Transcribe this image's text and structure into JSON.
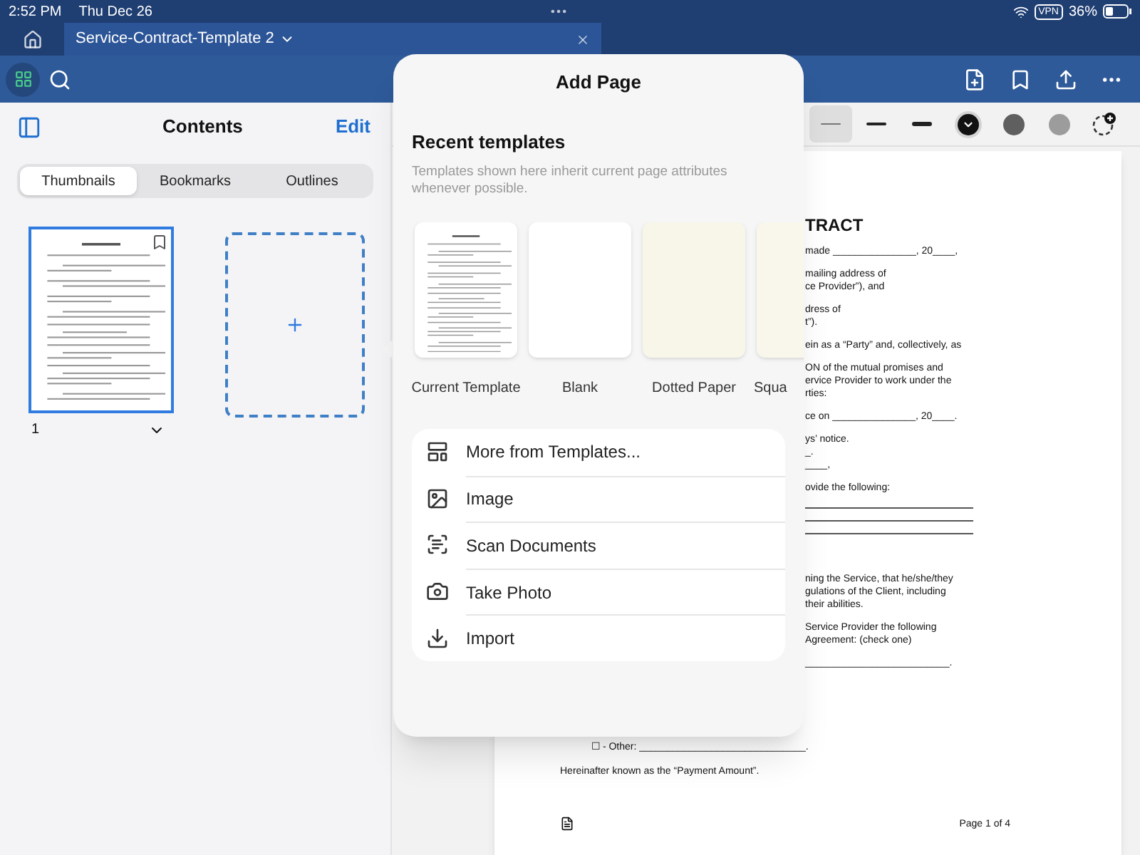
{
  "status_bar": {
    "time": "2:52 PM",
    "date": "Thu Dec 26",
    "vpn": "VPN",
    "battery": "36%"
  },
  "tabs": [
    {
      "title": "Service-Contract-Template 2",
      "selected": true
    }
  ],
  "sidebar": {
    "title": "Contents",
    "edit": "Edit",
    "segments": [
      {
        "label": "Thumbnails",
        "selected": true
      },
      {
        "label": "Bookmarks",
        "selected": false
      },
      {
        "label": "Outlines",
        "selected": false
      }
    ],
    "thumbnails": [
      {
        "page_number": "1",
        "selected": true
      }
    ]
  },
  "pen_toolbar": [
    {
      "kind": "thickness",
      "selected": true
    },
    {
      "kind": "thickness",
      "selected": false
    },
    {
      "kind": "thickness",
      "selected": false
    },
    {
      "kind": "color",
      "color": "#111111",
      "selected": true
    },
    {
      "kind": "color",
      "color": "#5f5f5f",
      "selected": false
    },
    {
      "kind": "color",
      "color": "#9c9c9c",
      "selected": false
    },
    {
      "kind": "add"
    }
  ],
  "popover": {
    "title": "Add Page",
    "section_title": "Recent templates",
    "hint": "Templates shown here inherit current page attributes whenever possible.",
    "templates": [
      {
        "label": "Current Template",
        "kind": "document"
      },
      {
        "label": "Blank",
        "kind": "blank"
      },
      {
        "label": "Dotted Paper",
        "kind": "dotted"
      },
      {
        "label": "Squa",
        "kind": "squared"
      }
    ],
    "actions": [
      {
        "label": "More from Templates...",
        "kind": "templates"
      },
      {
        "label": "Image",
        "kind": "image"
      },
      {
        "label": "Scan Documents",
        "kind": "scan"
      },
      {
        "label": "Take Photo",
        "kind": "camera"
      },
      {
        "label": "Import",
        "kind": "import"
      }
    ]
  },
  "document": {
    "paragraphs": [
      {
        "kind": "heading",
        "lines": [
          "TRACT"
        ]
      },
      {
        "kind": "text",
        "lines": [
          "made _______________, 20____,"
        ]
      },
      {
        "kind": "text",
        "lines": [
          "mailing address of",
          "ce Provider”), and"
        ]
      },
      {
        "kind": "text",
        "lines": [
          "dress of",
          "t”)."
        ]
      },
      {
        "kind": "text",
        "lines": [
          "ein as a “Party” and, collectively, as"
        ]
      },
      {
        "kind": "text",
        "lines": [
          "ON of the mutual promises and",
          "ervice Provider to work under the",
          "rties:"
        ]
      },
      {
        "kind": "text",
        "lines": [
          "ce on _______________, 20____."
        ]
      },
      {
        "kind": "text",
        "lines": [
          "ys’ notice.",
          "_.",
          "____,"
        ]
      },
      {
        "kind": "text",
        "lines": [
          "ovide the following:"
        ]
      },
      {
        "kind": "rules"
      },
      {
        "kind": "text",
        "lines": [
          "ning the Service, that he/she/they",
          "gulations of the Client, including",
          "their abilities."
        ]
      },
      {
        "kind": "text",
        "lines": [
          "Service Provider the following",
          "Agreement: (check one)"
        ]
      },
      {
        "kind": "text",
        "lines": [
          "__________________________."
        ]
      }
    ],
    "lower_lines": [
      "☐ - Other: ______________________________.",
      "Hereinafter known as the “Payment Amount”."
    ],
    "page_label": "Page 1 of 4"
  }
}
